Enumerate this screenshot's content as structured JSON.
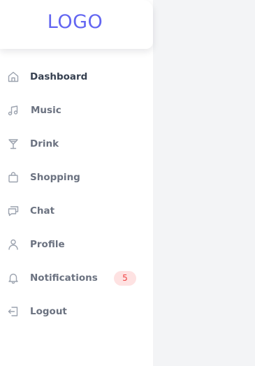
{
  "logo": {
    "text": "LOGO"
  },
  "colors": {
    "brand": "#6366f1",
    "badge_bg": "#fee2e2",
    "badge_text": "#ef4444",
    "content_bg": "#f3f4f6"
  },
  "nav": {
    "items": [
      {
        "label": "Dashboard",
        "icon": "home-icon",
        "active": true
      },
      {
        "label": "Music",
        "icon": "music-note-icon"
      },
      {
        "label": "Drink",
        "icon": "cocktail-glass-icon"
      },
      {
        "label": "Shopping",
        "icon": "shopping-bag-icon"
      },
      {
        "label": "Chat",
        "icon": "chat-bubbles-icon"
      },
      {
        "label": "Profile",
        "icon": "user-icon"
      },
      {
        "label": "Notifications",
        "icon": "bell-icon",
        "badge": "5"
      },
      {
        "label": "Logout",
        "icon": "logout-icon"
      }
    ]
  }
}
